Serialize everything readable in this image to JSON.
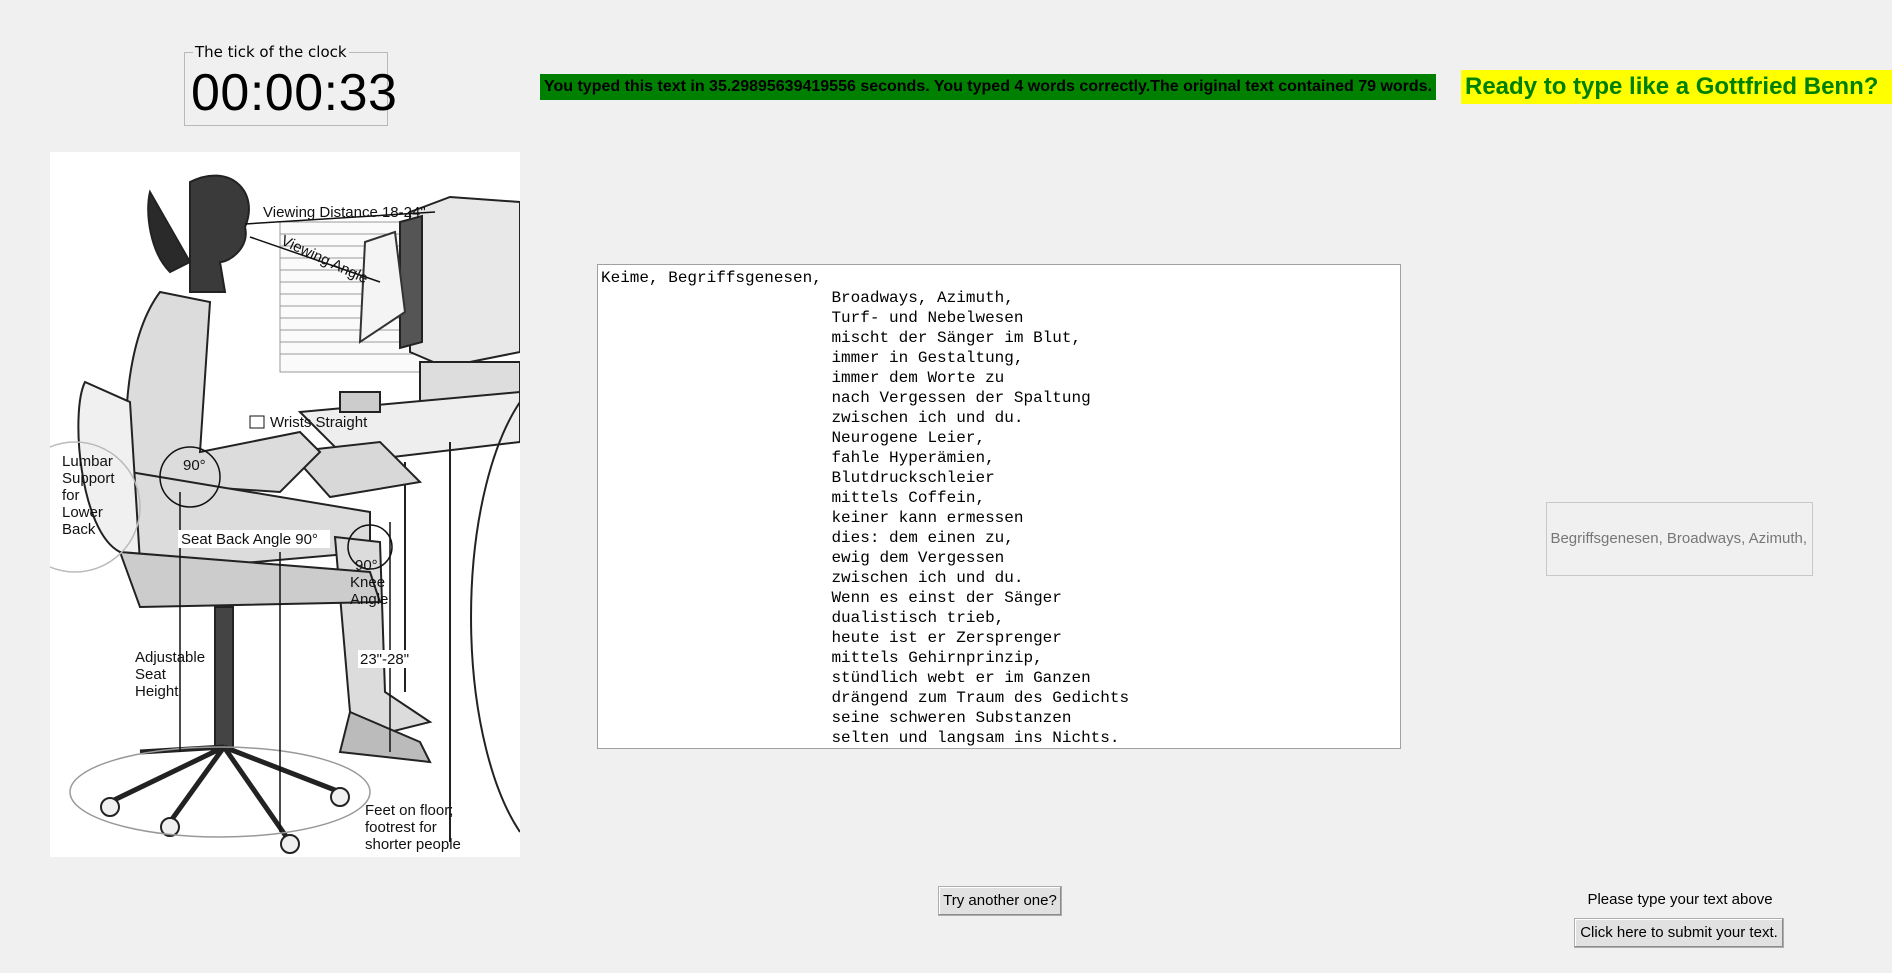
{
  "clock": {
    "frame_title": "The tick of the clock",
    "time": "00:00:33"
  },
  "result": {
    "message": "You typed this text in 35.29895639419556 seconds. You typed 4 words correctly.The original text contained 79 words.",
    "bar_color": "#008000"
  },
  "banner": {
    "text": "Ready to type like a Gottfried Benn?",
    "background": "#ffff00",
    "color": "#008000"
  },
  "image": {
    "labels": {
      "viewing_distance": "Viewing Distance 18-24\"",
      "viewing_angle": "Viewing Angle",
      "wrists": "Wrists Straight",
      "angle_90a": "90°",
      "lumbar": [
        "Lumbar",
        "Support",
        "for",
        "Lower",
        "Back"
      ],
      "seat_back": "Seat Back Angle 90°",
      "knee": [
        "90°",
        "Knee",
        "Angle"
      ],
      "seat_height": [
        "Adjustable",
        "Seat",
        "Height"
      ],
      "desk_height": "23\"-28\"",
      "feet": [
        "Feet on floor;",
        "footrest for",
        "shorter people"
      ]
    }
  },
  "poem": {
    "text": "Keime, Begriffsgenesen,\n                        Broadways, Azimuth,\n                        Turf- und Nebelwesen\n                        mischt der Sänger im Blut,\n                        immer in Gestaltung,\n                        immer dem Worte zu\n                        nach Vergessen der Spaltung\n                        zwischen ich und du.\n                        Neurogene Leier,\n                        fahle Hyperämien,\n                        Blutdruckschleier\n                        mittels Coffein,\n                        keiner kann ermessen\n                        dies: dem einen zu,\n                        ewig dem Vergessen\n                        zwischen ich und du.\n                        Wenn es einst der Sänger\n                        dualistisch trieb,\n                        heute ist er Zersprenger\n                        mittels Gehirnprinzip,\n                        stündlich webt er im Ganzen\n                        drängend zum Traum des Gedichts\n                        seine schweren Substanzen\n                        selten und langsam ins Nichts."
  },
  "typing_field": {
    "value": "Keime, Begriffsgenesen, Broadways, Azimuth,"
  },
  "buttons": {
    "try_another": "Try another one?",
    "submit": "Click here to submit your text."
  },
  "hint": "Please type your text above"
}
